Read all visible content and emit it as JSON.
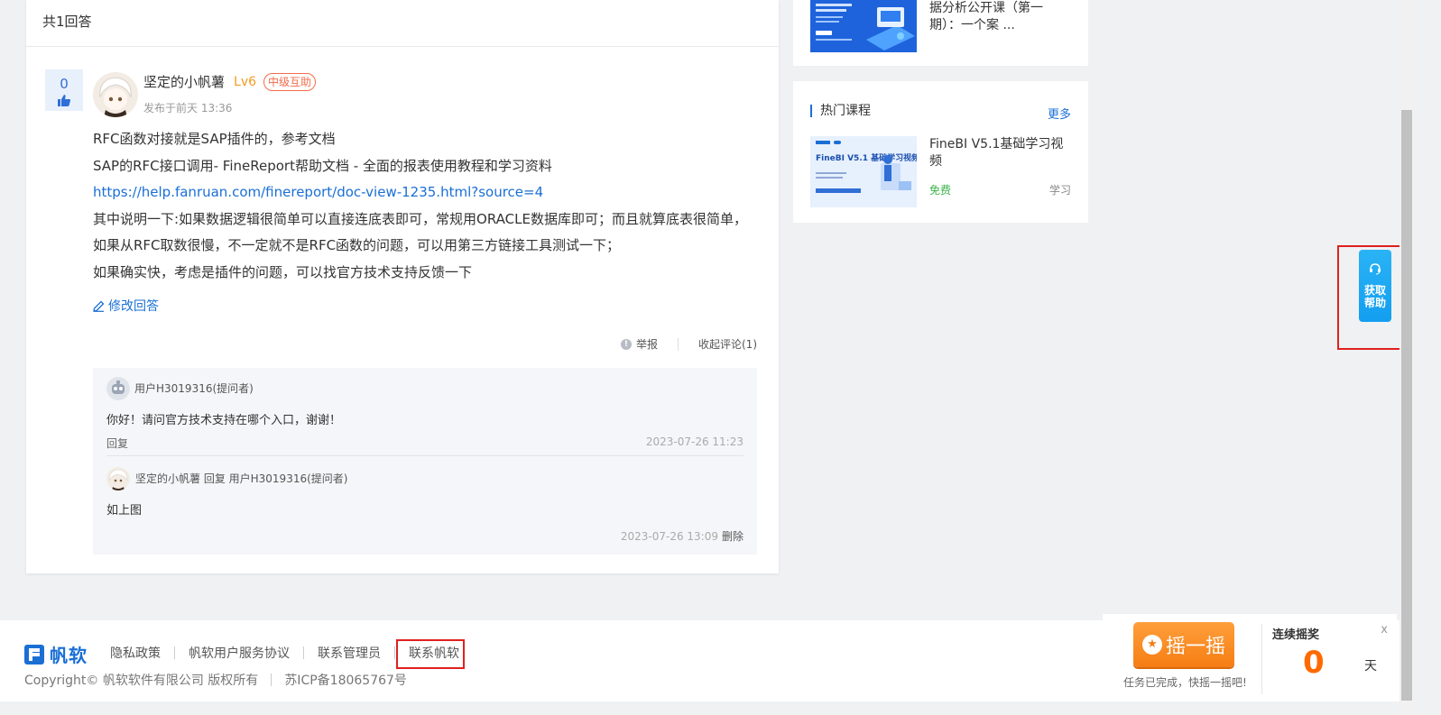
{
  "answers": {
    "count_label": "共1回答",
    "items": [
      {
        "votes": "0",
        "user_name": "坚定的小帆薯",
        "level": "Lv6",
        "badge": "中级互助",
        "time": "发布于前天 13:36",
        "body": [
          "RFC函数对接就是SAP插件的，参考文档",
          "SAP的RFC接口调用- FineReport帮助文档 - 全面的报表使用教程和学习资料",
          "https://help.fanruan.com/finereport/doc-view-1235.html?source=4",
          "其中说明一下:如果数据逻辑很简单可以直接连底表即可，常规用ORACLE数据库即可；而且就算底表很简单，如果从RFC取数很慢，不一定就不是RFC函数的问题，可以用第三方链接工具测试一下；",
          "如果确实快，考虑是插件的问题，可以找官方技术支持反馈一下"
        ],
        "edit_label": "修改回答",
        "report_label": "举报",
        "collapse_label": "收起评论(1)",
        "comments": [
          {
            "user": "用户H3019316(提问者)",
            "text": "你好！请问官方技术支持在哪个入口，谢谢！",
            "reply_label": "回复",
            "date": "2023-07-26 11:23"
          },
          {
            "user": "坚定的小帆薯 回复 用户H3019316(提问者)",
            "text": "如上图",
            "date": "2023-07-26 13:09",
            "delete_label": "删除"
          }
        ]
      }
    ]
  },
  "sidebar": {
    "top_course_title": "据分析公开课（第一期）：一个案 ...",
    "hot": {
      "title": "热门课程",
      "more": "更多",
      "course": {
        "title": "FineBI V5.1基础学习视频",
        "price": "免费",
        "action": "学习",
        "thumb_title": "FineBI V5.1 基础学习视频"
      }
    }
  },
  "help_float": {
    "label": "获取帮助"
  },
  "footer": {
    "brand": "帆软",
    "links": [
      "隐私政策",
      "帆软用户服务协议",
      "联系管理员",
      "联系帆软"
    ],
    "copyright": "Copyright© 帆软软件有限公司 版权所有",
    "icp": "苏ICP备18065767号"
  },
  "lucky": {
    "button": "摇一摇",
    "tip": "任务已完成，快摇一摇吧!",
    "streak_label": "连续摇奖",
    "streak_value": "0",
    "streak_unit": "天",
    "close": "x"
  },
  "colors": {
    "link": "#1a6fd5",
    "accent_orange": "#f57d14",
    "highlight_red": "#e02020",
    "level": "#f39a1f"
  }
}
